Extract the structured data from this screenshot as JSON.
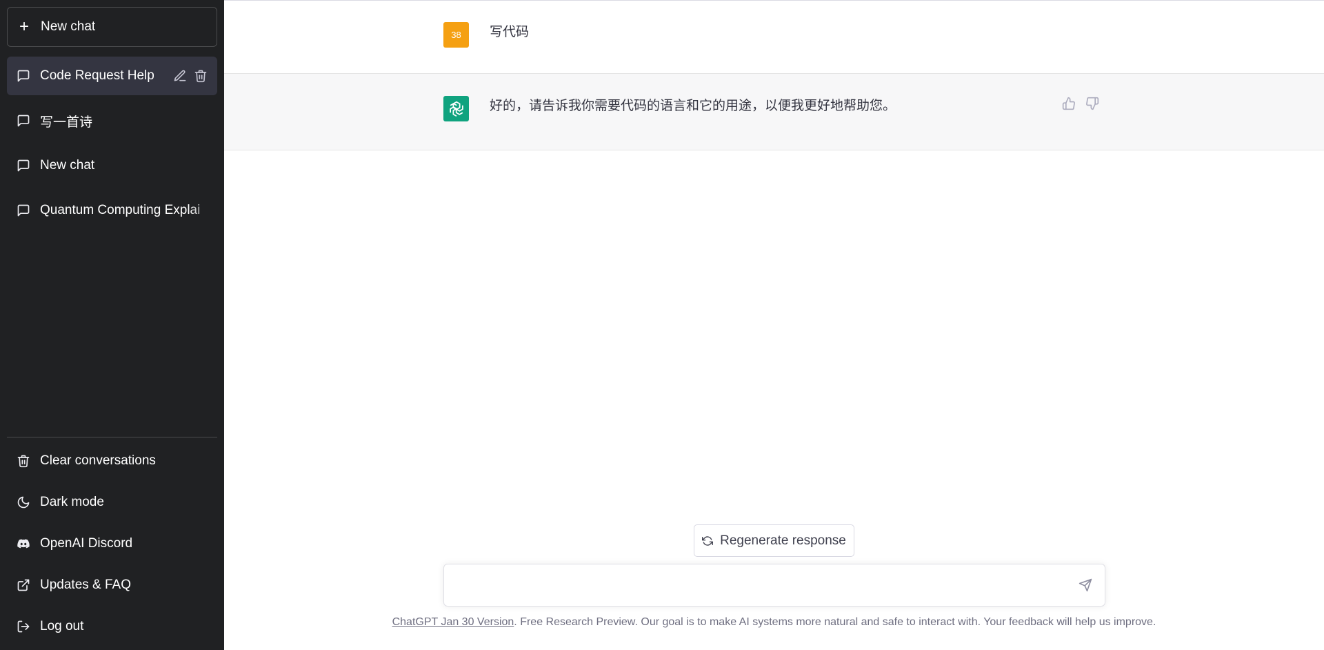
{
  "sidebar": {
    "new_chat_label": "New chat",
    "conversations": [
      {
        "label": "Code Request Help",
        "active": true
      },
      {
        "label": "写一首诗",
        "active": false
      },
      {
        "label": "New chat",
        "active": false
      },
      {
        "label": "Quantum Computing Explai",
        "active": false
      }
    ],
    "bottom_items": [
      {
        "label": "Clear conversations",
        "icon": "trash-icon"
      },
      {
        "label": "Dark mode",
        "icon": "moon-icon"
      },
      {
        "label": "OpenAI Discord",
        "icon": "discord-icon"
      },
      {
        "label": "Updates & FAQ",
        "icon": "external-link-icon"
      },
      {
        "label": "Log out",
        "icon": "logout-icon"
      }
    ]
  },
  "conversation": {
    "user_avatar_text": "38",
    "user_message": "写代码",
    "assistant_message": "好的，请告诉我你需要代码的语言和它的用途，以便我更好地帮助您。"
  },
  "regenerate_label": "Regenerate response",
  "input": {
    "placeholder": "",
    "value": ""
  },
  "footer": {
    "version_link": "ChatGPT Jan 30 Version",
    "text": ". Free Research Preview. Our goal is to make AI systems more natural and safe to interact with. Your feedback will help us improve."
  },
  "colors": {
    "sidebar_bg": "#202123",
    "active_item_bg": "#343541",
    "user_avatar": "#f5a012",
    "assistant_avatar": "#10a37f",
    "assistant_row_bg": "#f7f7f8"
  }
}
